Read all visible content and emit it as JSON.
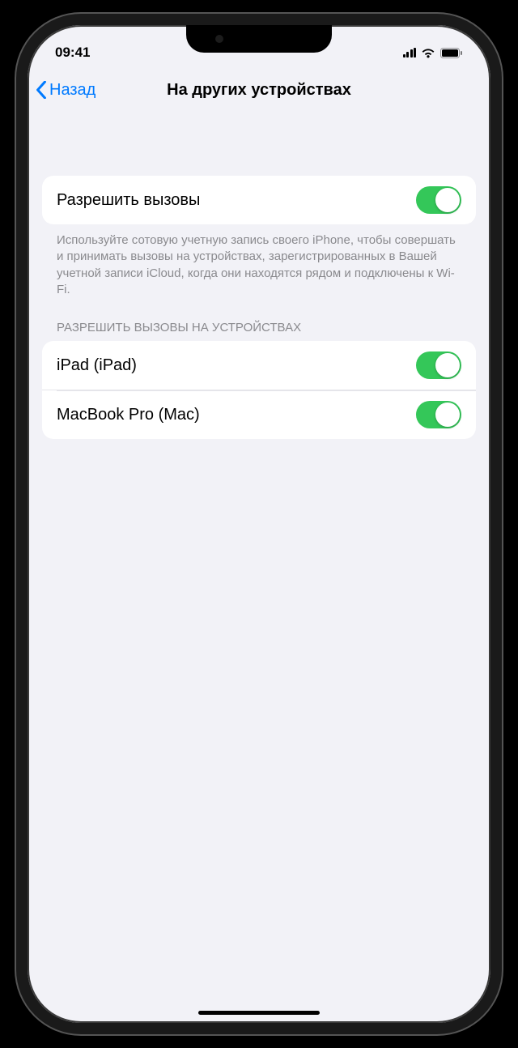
{
  "status": {
    "time": "09:41"
  },
  "nav": {
    "back_label": "Назад",
    "title": "На других устройствах"
  },
  "allow_calls": {
    "label": "Разрешить вызовы",
    "on": true,
    "footer": "Используйте сотовую учетную запись своего iPhone, чтобы совершать и принимать вызовы на устройствах, зарегистрированных в Вашей учетной записи iCloud, когда они находятся рядом и подключены к Wi-Fi."
  },
  "devices": {
    "header": "РАЗРЕШИТЬ ВЫЗОВЫ НА УСТРОЙСТВАХ",
    "items": [
      {
        "label": "iPad (iPad)",
        "on": true
      },
      {
        "label": "MacBook Pro (Mac)",
        "on": true
      }
    ]
  },
  "colors": {
    "accent": "#007aff",
    "switch_on": "#34c759"
  }
}
